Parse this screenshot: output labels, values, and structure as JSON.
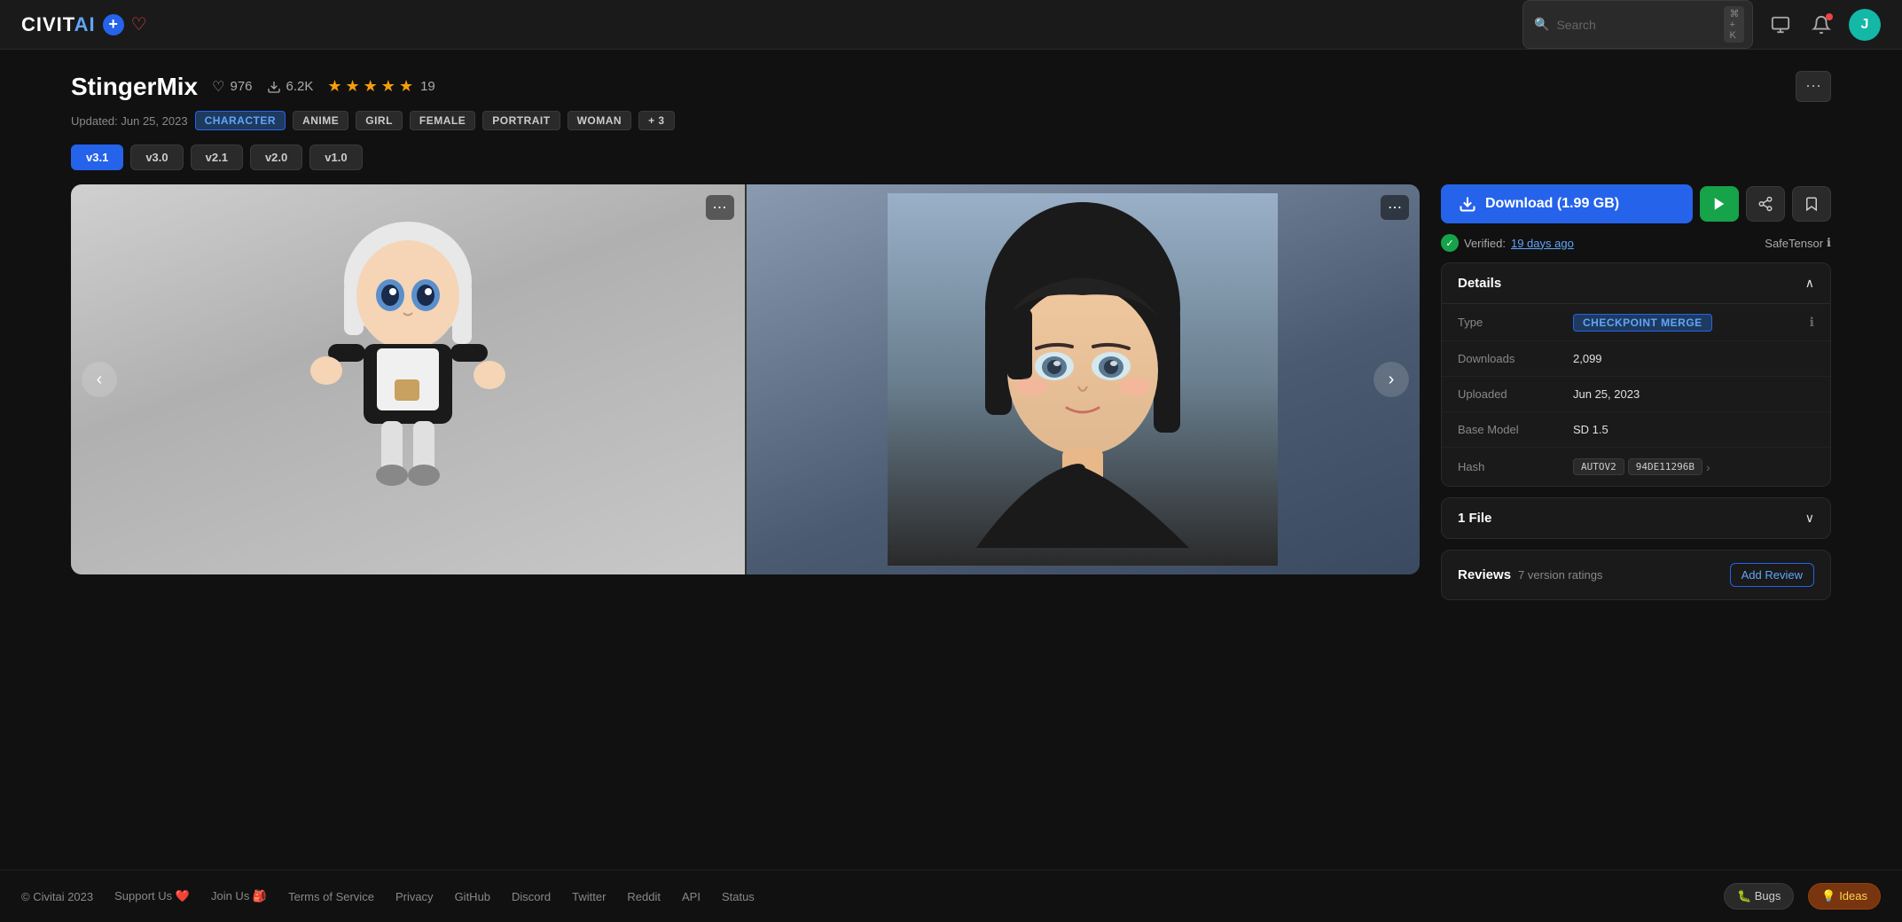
{
  "header": {
    "logo_text": "CIVIT",
    "logo_ai": "AI",
    "search_placeholder": "Search",
    "search_shortcut": "⌘ + K",
    "avatar_letter": "J"
  },
  "model": {
    "title": "StingerMix",
    "updated_text": "Updated: Jun 25, 2023",
    "like_count": "976",
    "download_count": "6.2K",
    "rating_count": "19",
    "tags": [
      "CHARACTER",
      "ANIME",
      "GIRL",
      "FEMALE",
      "PORTRAIT",
      "WOMAN",
      "+ 3"
    ],
    "versions": [
      "v3.1",
      "v3.0",
      "v2.1",
      "v2.0",
      "v1.0"
    ],
    "active_version": "v3.1"
  },
  "download": {
    "label": "Download (1.99 GB)"
  },
  "verified": {
    "text": "Verified:",
    "time": "19 days ago",
    "safetensor": "SafeTensor"
  },
  "details": {
    "title": "Details",
    "rows": [
      {
        "label": "Type",
        "value": "CHECKPOINT MERGE"
      },
      {
        "label": "Downloads",
        "value": "2,099"
      },
      {
        "label": "Uploaded",
        "value": "Jun 25, 2023"
      },
      {
        "label": "Base Model",
        "value": "SD 1.5"
      },
      {
        "label": "Hash",
        "value": ""
      }
    ],
    "hash_prefix": "AUTOV2",
    "hash_value": "94DE11296B"
  },
  "files": {
    "title": "1 File"
  },
  "reviews": {
    "title": "Reviews",
    "ratings_text": "7 version ratings",
    "add_review": "Add Review"
  },
  "footer": {
    "copyright": "© Civitai 2023",
    "links": [
      {
        "label": "Support Us ❤️",
        "icon": ""
      },
      {
        "label": "Join Us 🎒"
      },
      {
        "label": "Terms of Service"
      },
      {
        "label": "Privacy"
      },
      {
        "label": "GitHub"
      },
      {
        "label": "Discord"
      },
      {
        "label": "Twitter"
      },
      {
        "label": "Reddit"
      },
      {
        "label": "API"
      },
      {
        "label": "Status"
      }
    ],
    "bugs_label": "🐛 Bugs",
    "ideas_label": "💡 Ideas"
  }
}
